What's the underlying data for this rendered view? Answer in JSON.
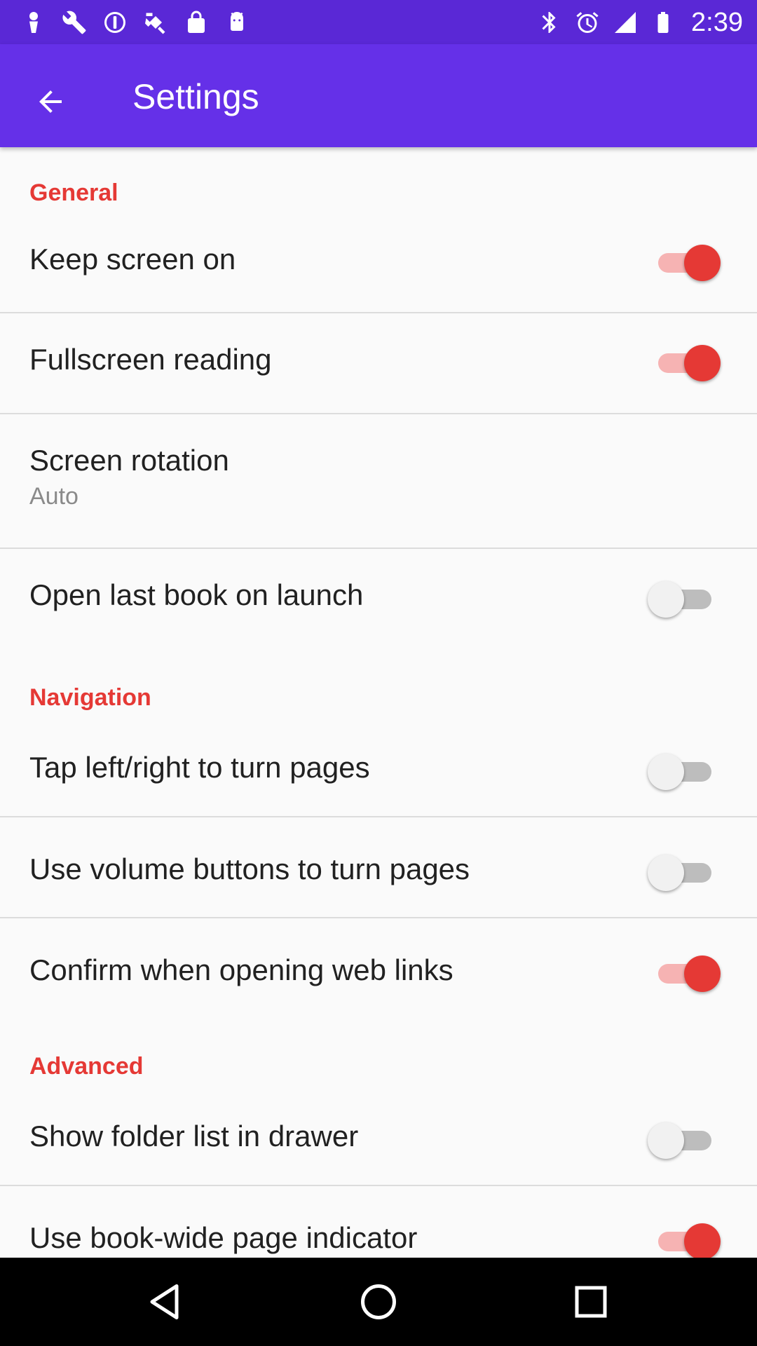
{
  "status_bar": {
    "time": "2:39",
    "left_icons": [
      "notification-icon",
      "wrench-icon",
      "info-icon",
      "satellite-icon",
      "lock-icon",
      "android-icon"
    ],
    "right_icons": [
      "bluetooth-icon",
      "alarm-icon",
      "signal-icon",
      "battery-icon"
    ]
  },
  "app_bar": {
    "title": "Settings",
    "background": "#6530e8"
  },
  "colors": {
    "accent": "#e53935",
    "switch_on_track": "#f6b3b3",
    "switch_off_thumb": "#f1f1f1"
  },
  "sections": {
    "general": {
      "header": "General",
      "items": [
        {
          "title": "Keep screen on",
          "switch": "on"
        },
        {
          "title": "Fullscreen reading",
          "switch": "on"
        },
        {
          "title": "Screen rotation",
          "summary": "Auto"
        },
        {
          "title": "Open last book on launch",
          "switch": "off"
        }
      ]
    },
    "navigation": {
      "header": "Navigation",
      "items": [
        {
          "title": "Tap left/right to turn pages",
          "switch": "off"
        },
        {
          "title": "Use volume buttons to turn pages",
          "switch": "off"
        },
        {
          "title": "Confirm when opening web links",
          "switch": "on"
        }
      ]
    },
    "advanced": {
      "header": "Advanced",
      "items": [
        {
          "title": "Show folder list in drawer",
          "switch": "off"
        },
        {
          "title": "Use book-wide page indicator",
          "switch": "on"
        }
      ]
    }
  },
  "nav_bar": {
    "buttons": [
      "back-icon",
      "home-icon",
      "recents-icon"
    ]
  }
}
